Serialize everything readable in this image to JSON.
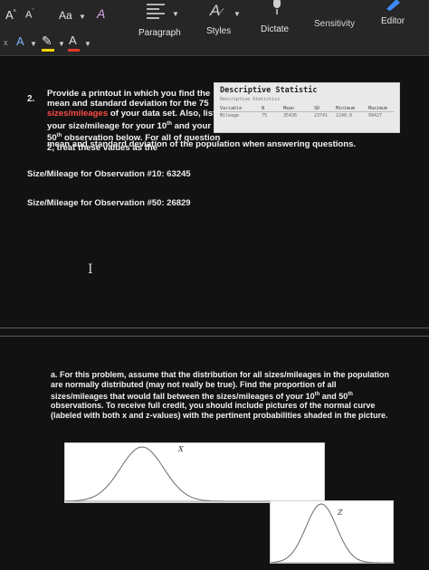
{
  "ribbon": {
    "font_grow": "A",
    "font_shrink": "A",
    "change_case": "Aa",
    "clear_format": "A",
    "highlight_color": "#f2d300",
    "font_color": "#e23a2e",
    "font_color_glyph": "A",
    "font_effects_glyph": "A",
    "groups": {
      "paragraph": "Paragraph",
      "styles": "Styles",
      "dictate": "Dictate",
      "sensitivity": "Sensitivity",
      "editor": "Editor"
    }
  },
  "question": {
    "number": "2.",
    "intro_1": "Provide a printout in which you find the mean and standard deviation for the 75 ",
    "intro_highlight": "sizes/mileages",
    "intro_2": " of your data set. Also, list your size/mileage for your 10",
    "sup_th_1": "th",
    "intro_3": " and your 50",
    "sup_th_2": "th",
    "intro_4": " observation below. For all of question 2, treat these values as the",
    "intro_full": "mean and standard deviation of the population when answering questions."
  },
  "stats_table": {
    "title": "Descriptive Statistic",
    "subtitle": "Descriptive Statistics",
    "headers": [
      "Variable",
      "N",
      "Mean",
      "SD",
      "Minimum",
      "Maximum"
    ],
    "row": [
      "Mileage",
      "75",
      "35436",
      "23741",
      "2240.0",
      "99427"
    ]
  },
  "observations": {
    "obs10": "Size/Mileage for Observation #10:  63245",
    "obs50": "Size/Mileage for Observation #50:  26829"
  },
  "part_a": {
    "text_1": "a. For this problem, assume that the distribution for all sizes/mileages in the population are normally distributed (may not really be true). Find the proportion of all sizes/mileages that would fall between the sizes/mileages of your 10",
    "sup_th_1": "th",
    "text_2": " and 50",
    "sup_th_2": "th",
    "text_3": " observations. To receive full credit, you should include pictures of the normal curve (labeled with both x and z-values) with the pertinent probabilities shaded in the picture."
  },
  "graphs": {
    "x_label": "X",
    "z_label": "Z"
  },
  "colors": {
    "highlight_text": "#ff4a44",
    "ribbon_bg": "#262626",
    "page_bg": "#121212"
  }
}
